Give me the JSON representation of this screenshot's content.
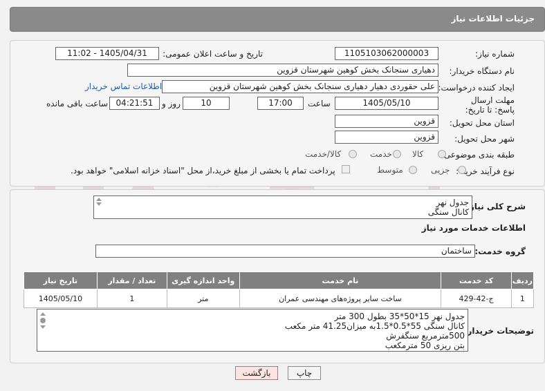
{
  "header": {
    "title": "جزئیات اطلاعات نیاز"
  },
  "fields": {
    "need_number_label": "شماره نیاز:",
    "need_number": "1105103062000003",
    "announce_label": "تاریخ و ساعت اعلان عمومی:",
    "announce_value": "1405/04/31 - 11:02",
    "buyer_label": "نام دستگاه خریدار:",
    "buyer_value": "دهیاری سنجانک بخش کوهین شهرستان قزوین",
    "creator_label": "ایجاد کننده درخواست:",
    "creator_value": "علی حقوردی دهیار دهیاری سنجانک بخش کوهین شهرستان قزوین",
    "contact_link": "اطلاعات تماس خریدار",
    "deadline_label": "مهلت ارسال پاسخ: تا تاریخ:",
    "deadline_date": "1405/05/10",
    "time_label": "ساعت",
    "deadline_time": "17:00",
    "days_value": "10",
    "days_label": "روز و",
    "remaining_time": "04:21:51",
    "remaining_label": "ساعت باقی مانده",
    "province_label": "استان محل تحویل:",
    "province_value": "قزوین",
    "city_label": "شهر محل تحویل:",
    "city_value": "قزوین",
    "category_label": "طبقه بندی موضوعی:",
    "category_options": [
      "کالا",
      "خدمت",
      "کالا/خدمت"
    ],
    "purchase_type_label": "نوع فرآیند خرید :",
    "purchase_options": [
      "جزیی",
      "متوسط"
    ],
    "payment_note": "پرداخت تمام یا بخشی از مبلغ خرید،از محل \"اسناد خزانه اسلامی\" خواهد بود."
  },
  "summary": {
    "label": "شرح کلی نیاز:",
    "lines": [
      "جدول نهر",
      "کانال سنگی"
    ]
  },
  "services": {
    "section_title": "اطلاعات خدمات مورد نیاز",
    "group_label": "گروه خدمت:",
    "group_value": "ساختمان",
    "columns": [
      "ردیف",
      "کد خدمت",
      "نام خدمت",
      "واحد اندازه گیری",
      "تعداد / مقدار",
      "تاریخ نیاز"
    ],
    "rows": [
      [
        "1",
        "ج-42-429",
        "ساخت سایر پروژه‌های مهندسی عمران",
        "متر",
        "1",
        "1405/05/10"
      ]
    ]
  },
  "buyer_notes": {
    "label": "توضیحات خریدار:",
    "lines": [
      "جدول نهر 15*50*35 بطول 300 متر",
      "کانال سنگی 55*0.5*1.5به میزان41.25 متر مکعب",
      "500مترمربع سنگفرش",
      "بتن ریزی 50 مترمکعب"
    ]
  },
  "buttons": {
    "print": "چاپ",
    "back": "بازگشت"
  },
  "watermark": {
    "text": "AriaTender.neT"
  },
  "colors": {
    "header_bg": "#8a8a8a",
    "table_header_bg": "#808080",
    "back_button_bg": "#fde4e4",
    "link": "#1a5fb4"
  }
}
